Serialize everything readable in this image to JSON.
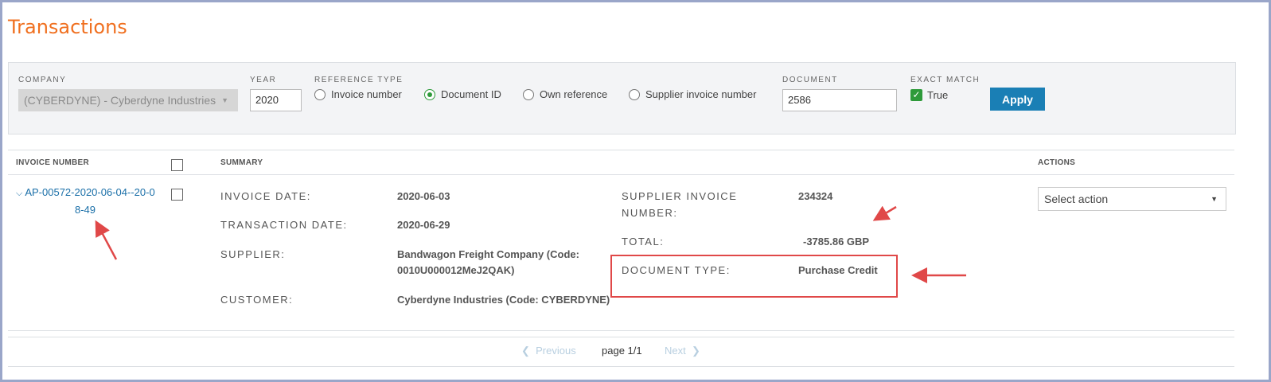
{
  "page": {
    "title": "Transactions"
  },
  "filters": {
    "company": {
      "label": "COMPANY",
      "value": "(CYBERDYNE) - Cyberdyne Industries"
    },
    "year": {
      "label": "YEAR",
      "value": "2020"
    },
    "reference_type": {
      "label": "REFERENCE TYPE",
      "options": [
        "Invoice number",
        "Document ID",
        "Own reference",
        "Supplier invoice number"
      ],
      "selected": "Document ID"
    },
    "document": {
      "label": "DOCUMENT",
      "value": "2586"
    },
    "exact_match": {
      "label": "EXACT MATCH",
      "text": "True",
      "checked": true
    },
    "apply_label": "Apply"
  },
  "table": {
    "headers": {
      "invoice_number": "INVOICE NUMBER",
      "summary": "SUMMARY",
      "actions": "ACTIONS"
    },
    "row": {
      "invoice_line1": "AP-00572-2020-06-04--20-0",
      "invoice_line2": "8-49",
      "invoice_date_label": "INVOICE DATE:",
      "invoice_date": "2020-06-03",
      "transaction_date_label": "TRANSACTION DATE:",
      "transaction_date": "2020-06-29",
      "supplier_label": "SUPPLIER:",
      "supplier_line1": "Bandwagon Freight Company (Code:",
      "supplier_line2": "0010U000012MeJ2QAK)",
      "customer_label": "CUSTOMER:",
      "customer": "Cyberdyne Industries (Code: CYBERDYNE)",
      "supplier_invoice_label1": "SUPPLIER INVOICE",
      "supplier_invoice_label2": "NUMBER:",
      "supplier_invoice_number": "234324",
      "total_label": "TOTAL:",
      "total": "-3785.86 GBP",
      "document_type_label": "DOCUMENT TYPE:",
      "document_type": "Purchase Credit",
      "action_placeholder": "Select action"
    }
  },
  "pagination": {
    "previous": "Previous",
    "page": "page 1/1",
    "next": "Next"
  },
  "colors": {
    "title": "#f07020",
    "link": "#1a6fa8",
    "apply": "#1a7fb5",
    "check": "#2e9a3a",
    "annotation": "#e04848"
  }
}
